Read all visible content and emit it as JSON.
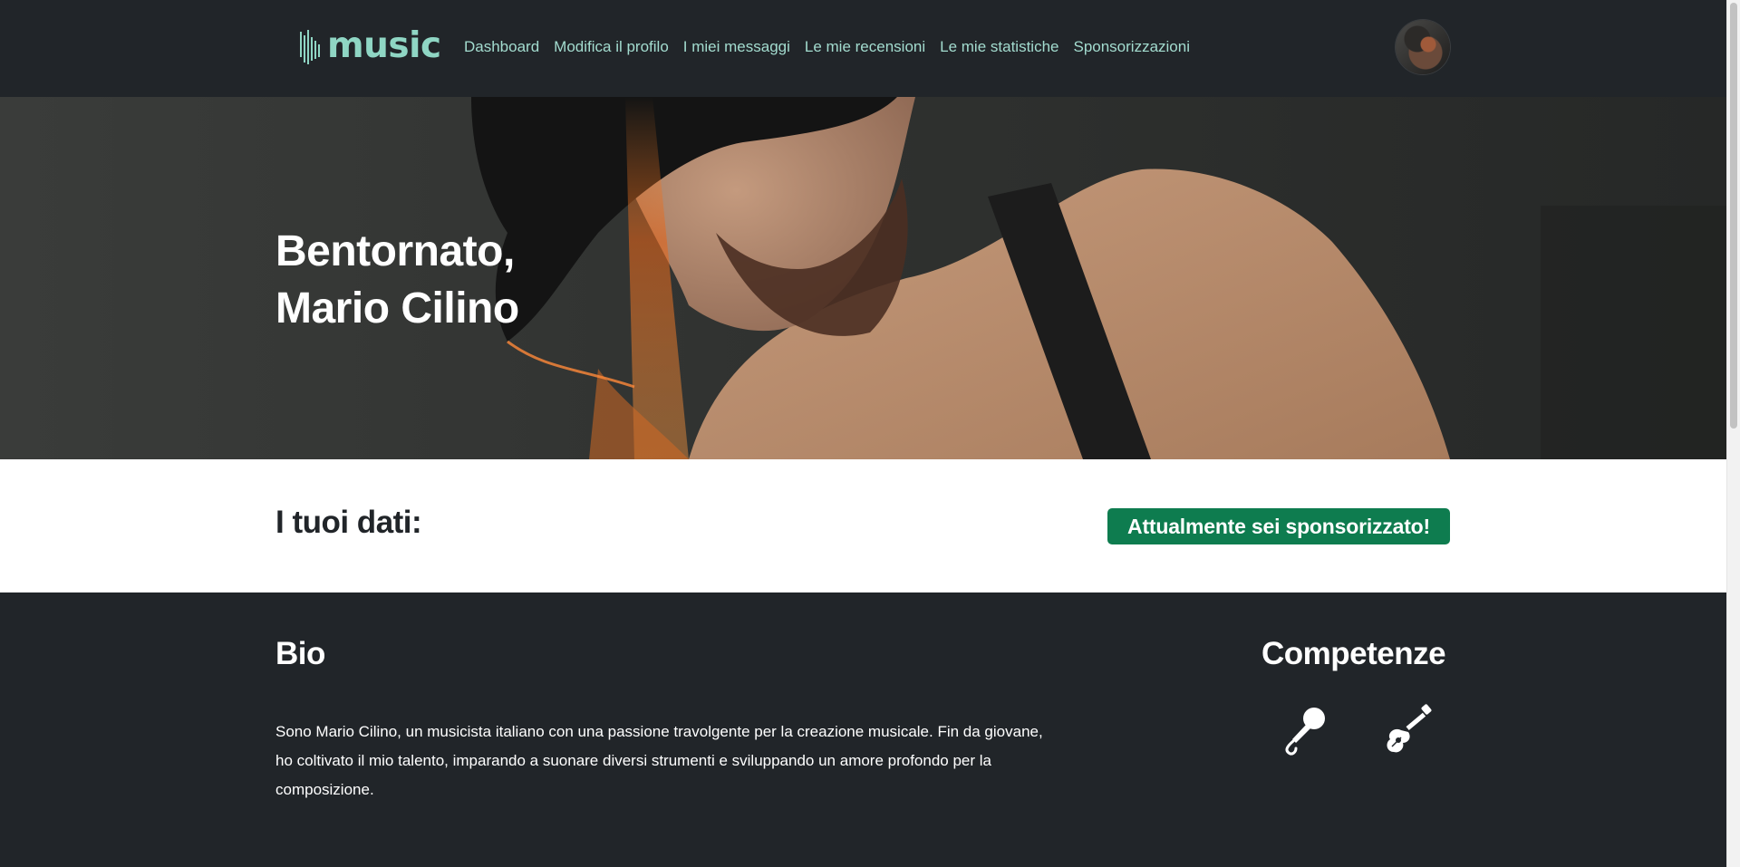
{
  "navbar": {
    "brand": "music",
    "links": [
      {
        "label": "Dashboard"
      },
      {
        "label": "Modifica il profilo"
      },
      {
        "label": "I miei messaggi"
      },
      {
        "label": "Le mie recensioni"
      },
      {
        "label": "Le mie statistiche"
      },
      {
        "label": "Sponsorizzazioni"
      }
    ],
    "avatar_icon": "user-avatar"
  },
  "hero": {
    "greeting_line1": "Bentornato,",
    "greeting_line2": "Mario Cilino"
  },
  "dati": {
    "title": "I tuoi dati:",
    "sponsor_badge": "Attualmente sei sponsorizzato!"
  },
  "bio": {
    "title": "Bio",
    "text": "Sono Mario Cilino, un musicista italiano con una passione travolgente per la creazione musicale. Fin da giovane, ho coltivato il mio talento, imparando a suonare diversi strumenti e sviluppando un amore profondo per la composizione."
  },
  "competenze": {
    "title": "Competenze",
    "icons": [
      "microphone-icon",
      "guitar-icon"
    ]
  },
  "colors": {
    "dark_bg": "#212529",
    "accent_mint": "#8fd6c4",
    "nav_link": "#a3dccf",
    "badge_green": "#0e7c4f",
    "hero_skin": "#b88a6c"
  }
}
